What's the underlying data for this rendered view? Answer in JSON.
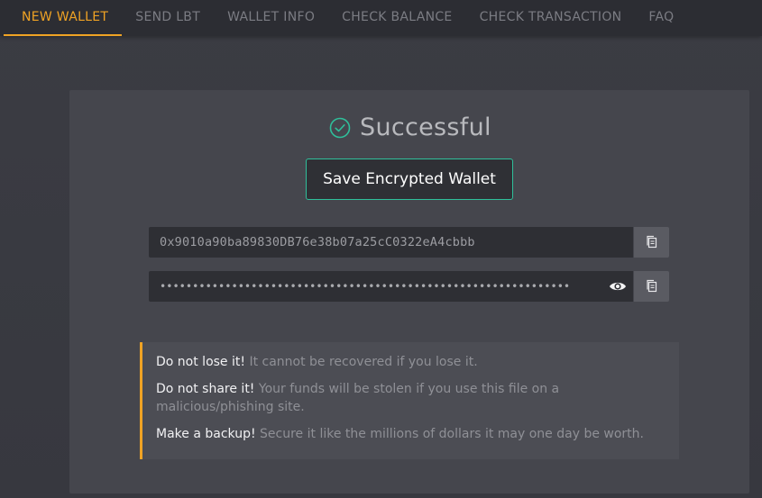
{
  "nav": {
    "items": [
      {
        "label": "NEW WALLET",
        "active": true
      },
      {
        "label": "SEND LBT",
        "active": false
      },
      {
        "label": "WALLET INFO",
        "active": false
      },
      {
        "label": "CHECK BALANCE",
        "active": false
      },
      {
        "label": "CHECK TRANSACTION",
        "active": false
      },
      {
        "label": "FAQ",
        "active": false
      }
    ],
    "accent_color": "#f0a324"
  },
  "status": {
    "icon": "check-circle-icon",
    "text": "Successful",
    "color": "#2fbf9a"
  },
  "save_button": {
    "label": "Save Encrypted Wallet"
  },
  "address_field": {
    "value": "0x9010a90ba89830DB76e38b07a25cC0322eA4cbbb",
    "copy_icon": "copy-icon"
  },
  "secret_field": {
    "masked_value": "•••••••••••••••••••••••••••••••••••••••••••••••••••••••••••••••",
    "reveal_icon": "eye-icon",
    "copy_icon": "copy-icon"
  },
  "warnings": [
    {
      "strong": "Do not lose it!",
      "text": "It cannot be recovered if you lose it."
    },
    {
      "strong": "Do not share it!",
      "text": "Your funds will be stolen if you use this file on a malicious/phishing site."
    },
    {
      "strong": "Make a backup!",
      "text": "Secure it like the millions of dollars it may one day be worth."
    }
  ]
}
